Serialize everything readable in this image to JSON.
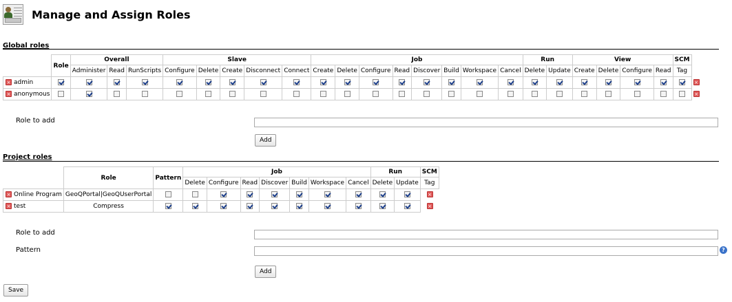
{
  "page": {
    "title": "Manage and Assign Roles"
  },
  "global": {
    "section_title": "Global roles",
    "role_header": "Role",
    "groups": [
      {
        "label": "Overall",
        "cols": [
          "Administer",
          "Read",
          "RunScripts"
        ]
      },
      {
        "label": "Slave",
        "cols": [
          "Configure",
          "Delete",
          "Create",
          "Disconnect",
          "Connect"
        ]
      },
      {
        "label": "Job",
        "cols": [
          "Create",
          "Delete",
          "Configure",
          "Read",
          "Discover",
          "Build",
          "Workspace",
          "Cancel"
        ]
      },
      {
        "label": "Run",
        "cols": [
          "Delete",
          "Update"
        ]
      },
      {
        "label": "View",
        "cols": [
          "Create",
          "Delete",
          "Configure",
          "Read"
        ]
      },
      {
        "label": "SCM",
        "cols": [
          "Tag"
        ]
      }
    ],
    "rows": [
      {
        "name": "admin",
        "checks": [
          1,
          1,
          1,
          1,
          1,
          1,
          1,
          1,
          1,
          1,
          1,
          1,
          1,
          1,
          1,
          1,
          1,
          1,
          1,
          1,
          1,
          1,
          1,
          1
        ]
      },
      {
        "name": "anonymous",
        "checks": [
          0,
          1,
          0,
          0,
          0,
          0,
          0,
          0,
          0,
          0,
          0,
          0,
          0,
          0,
          0,
          0,
          0,
          0,
          0,
          0,
          0,
          0,
          0,
          0
        ]
      }
    ],
    "role_to_add_label": "Role to add",
    "role_to_add_value": "",
    "add_label": "Add"
  },
  "project": {
    "section_title": "Project roles",
    "role_header": "Role",
    "pattern_header": "Pattern",
    "groups": [
      {
        "label": "Job",
        "cols": [
          "Delete",
          "Configure",
          "Read",
          "Discover",
          "Build",
          "Workspace",
          "Cancel"
        ]
      },
      {
        "label": "Run",
        "cols": [
          "Delete",
          "Update"
        ]
      },
      {
        "label": "SCM",
        "cols": [
          "Tag"
        ]
      }
    ],
    "rows": [
      {
        "name": "Online Program",
        "pattern": "GeoQPortal|GeoQUserPortal",
        "checks": [
          0,
          0,
          1,
          1,
          1,
          1,
          1,
          1,
          1,
          1
        ]
      },
      {
        "name": "test",
        "pattern": "Compress",
        "checks": [
          1,
          1,
          1,
          1,
          1,
          1,
          1,
          1,
          1,
          1
        ]
      }
    ],
    "role_to_add_label": "Role to add",
    "role_to_add_value": "",
    "pattern_label": "Pattern",
    "pattern_value": "",
    "add_label": "Add"
  },
  "save_label": "Save",
  "icons": {
    "delete": "delete-icon",
    "help": "help-icon",
    "logo": "jenkins-id-card-logo"
  },
  "colors": {
    "check": "#1a3d8a",
    "delete": "#e05a5a",
    "help": "#3a72c9"
  }
}
